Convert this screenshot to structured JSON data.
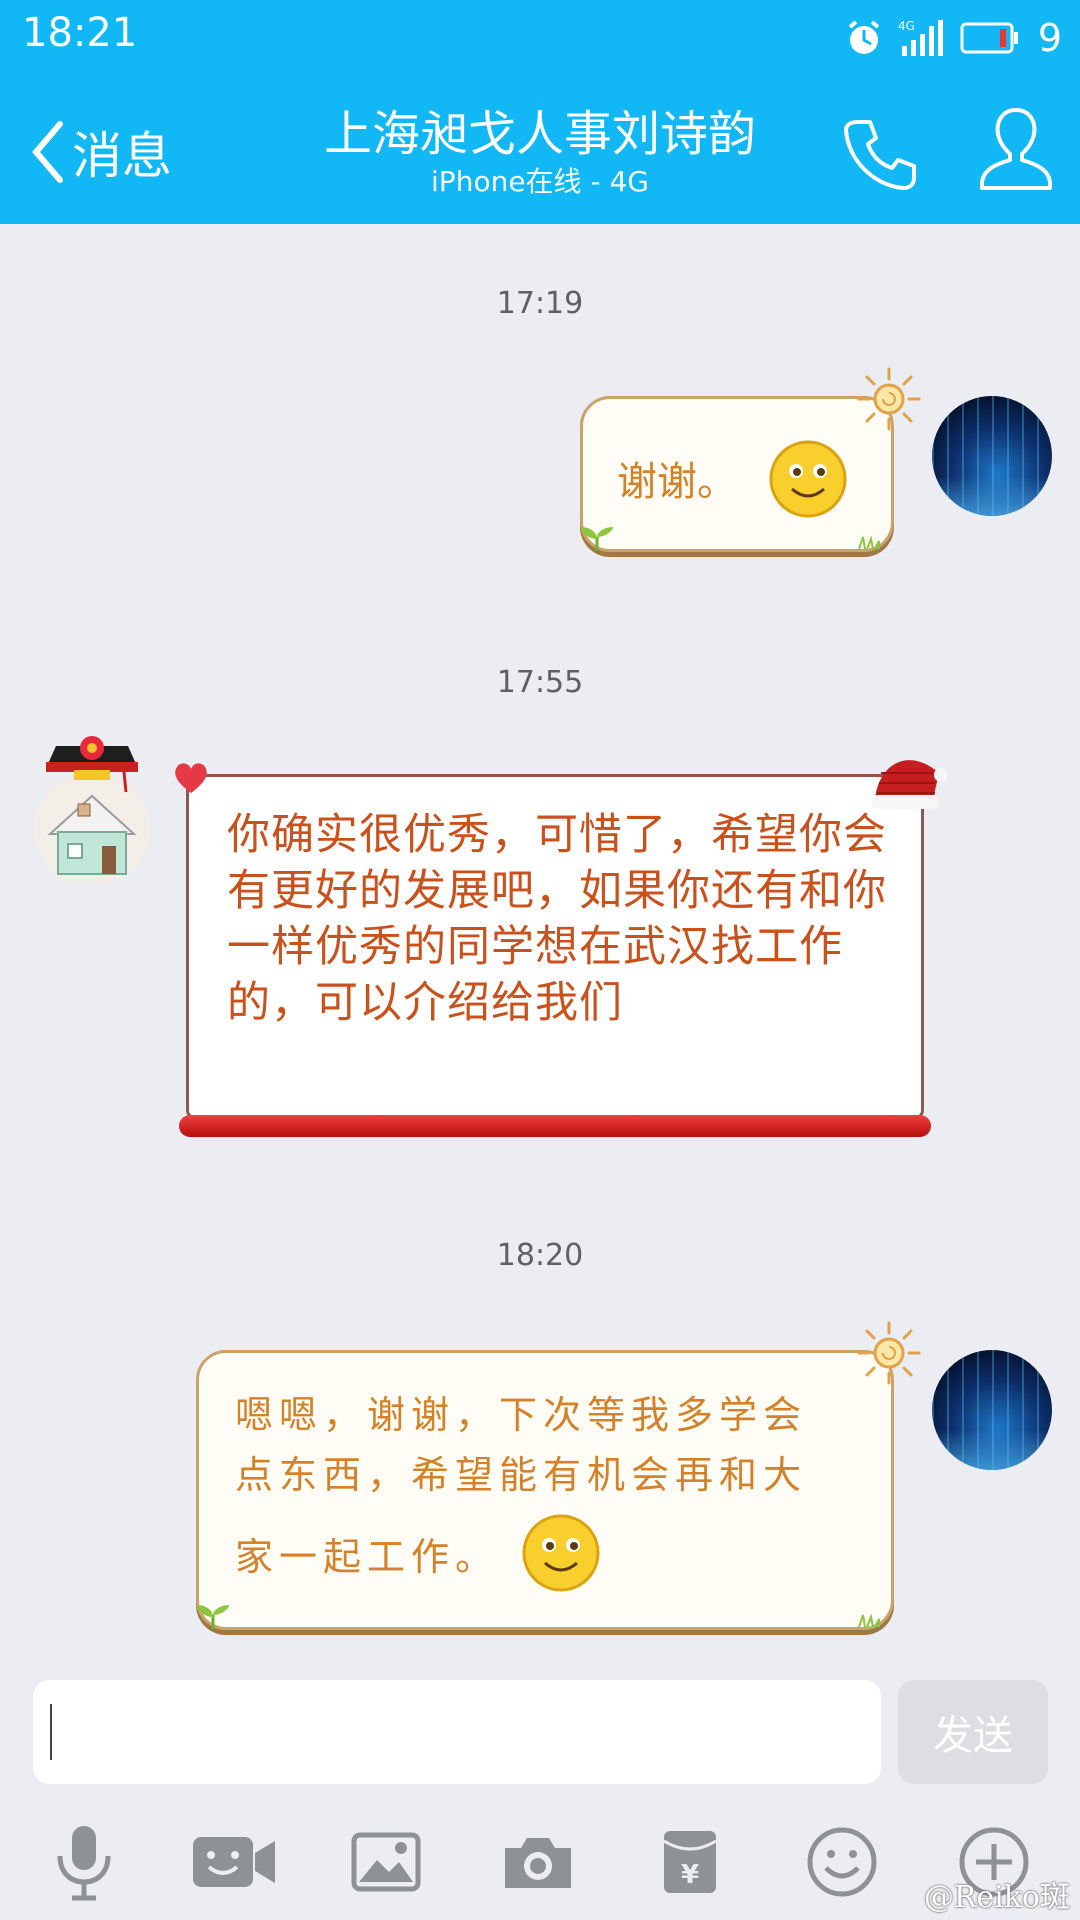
{
  "status_bar": {
    "time": "18:21",
    "network": "4G",
    "battery": "9"
  },
  "header": {
    "back_label": "消息",
    "title": "上海昶戈人事刘诗韵",
    "subtitle": "iPhone在线 - 4G"
  },
  "messages": [
    {
      "timestamp": "17:19",
      "direction": "outgoing",
      "text": "谢谢。"
    },
    {
      "timestamp": "17:55",
      "direction": "incoming",
      "text": "你确实很优秀，可惜了，希望你会有更好的发展吧，如果你还有和你一样优秀的同学想在武汉找工作的，可以介绍给我们"
    },
    {
      "timestamp": "18:20",
      "direction": "outgoing",
      "text_line1": "嗯嗯，谢谢，下次等我多学会",
      "text_line2": "点东西，希望能有机会再和大",
      "text_line3": "家一起工作。"
    }
  ],
  "composer": {
    "input_value": "",
    "send_label": "发送"
  },
  "toolbar": [
    "microphone-icon",
    "video-icon",
    "image-icon",
    "camera-icon",
    "red-packet-icon",
    "emoji-icon",
    "plus-icon"
  ],
  "colors": {
    "header": "#12b7f5",
    "background": "#ebedf2",
    "incoming_text": "#c8511c",
    "outgoing_text": "#d3822a"
  },
  "watermark": "@Reiko斑"
}
